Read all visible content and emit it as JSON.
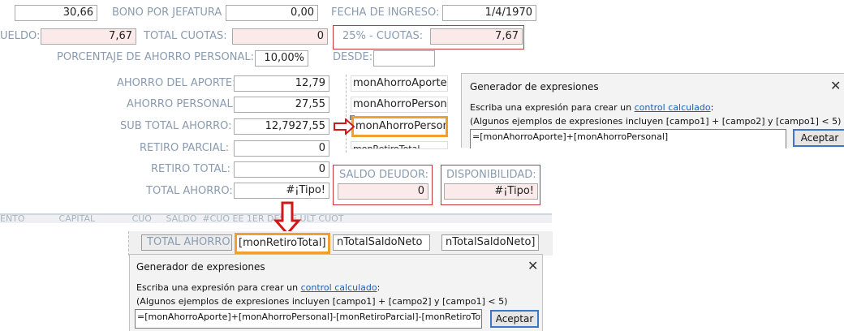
{
  "top_form": {
    "row1": {
      "value1": "30,66",
      "bono_label": "BONO POR JEFATURA",
      "bono_value": "0,00",
      "fecha_label": "FECHA DE  INGRESO:",
      "fecha_value": "1/4/1970"
    },
    "row2": {
      "sueldo_label": "UELDO:",
      "sueldo_value": "7,67",
      "total_cuotas_label": "TOTAL CUOTAS:",
      "total_cuotas_value": "0",
      "cuotas25_label": "25% - CUOTAS:",
      "cuotas25_value": "7,67"
    },
    "row3": {
      "porcentaje_label": "PORCENTAJE DE AHORRO PERSONAL:",
      "porcentaje_value": "10,00%",
      "desde_label": "DESDE:",
      "desde_value": ""
    },
    "ahorro_aporte_label": "AHORRO DEL APORTE:",
    "ahorro_aporte_value": "12,79",
    "ahorro_personal_label": "AHORRO PERSONAL:",
    "ahorro_personal_value": "27,55",
    "sub_total_label": "SUB TOTAL AHORRO:",
    "sub_total_value": "12,7927,55",
    "retiro_parcial_label": "RETIRO PARCIAL:",
    "retiro_parcial_value": "0",
    "retiro_total_label": "RETIRO TOTAL:",
    "retiro_total_value": "0",
    "total_ahorro_label": "TOTAL AHORRO:",
    "total_ahorro_value": "#¡Tipo!",
    "saldo_deudor_label": "SALDO DEUDOR:",
    "saldo_deudor_value": "0",
    "disponibilidad_label": "DISPONIBILIDAD:",
    "disponibilidad_value": "#¡Tipo!"
  },
  "design_controls": {
    "ctl1": "monAhorroAporte",
    "ctl2": "monAhorroPersonal",
    "ctl3": "monAhorroPersonal]",
    "ctl4": "monRetiroTotal"
  },
  "dialog1": {
    "title": "Generador de expresiones",
    "line1_pre": "Escriba una expresión para crear un ",
    "line1_link": "control calculado",
    "line1_post": ":",
    "line2": "(Algunos ejemplos de expresiones incluyen [campo1] + [campo2] y [campo1] < 5)",
    "expression": "=[monAhorroAporte]+[monAhorroPersonal]",
    "accept_label": "Aceptar",
    "close_glyph": "✕"
  },
  "bottom_strip": {
    "header_text": "ENTO            CAPITAL             CUO     SALDO  #CUO EE 1ER DESCE ULT CUOT",
    "total_ahorro_label": "TOTAL AHORRO:",
    "ret_total_control": "[monRetiroTotal]",
    "saldo_neto_1": "nTotalSaldoNeto",
    "saldo_neto_2": "nTotalSaldoNeto]"
  },
  "dialog2": {
    "title": "Generador de expresiones",
    "line1_pre": "Escriba una expresión para crear un ",
    "line1_link": "control calculado",
    "line1_post": ":",
    "line2": "(Algunos ejemplos de expresiones incluyen [campo1] + [campo2] y [campo1] < 5)",
    "expression": "=[monAhorroAporte]+[monAhorroPersonal]-[monRetiroParcial]-[monRetiroTotal]",
    "accept_label": "Aceptar",
    "close_glyph": "✕"
  },
  "colors": {
    "label": "#8a9bb0",
    "highlight_red": "#c8333c",
    "highlight_orange": "#f0a030",
    "pink_field": "#fbeaea"
  }
}
